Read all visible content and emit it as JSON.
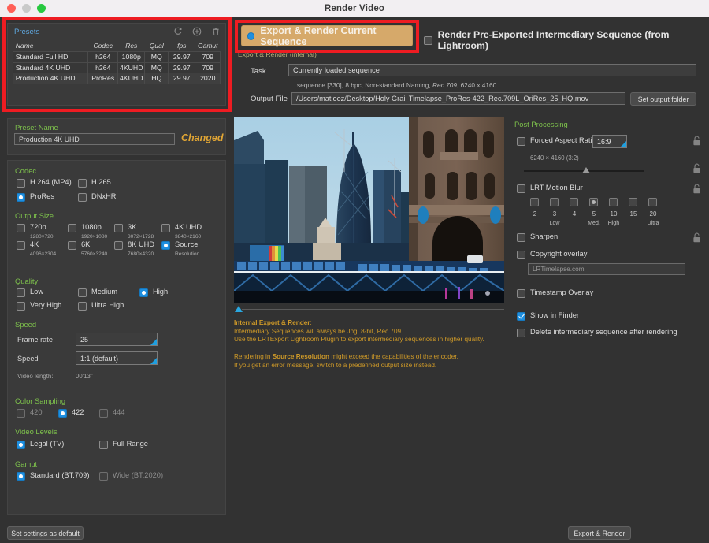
{
  "window": {
    "title": "Render Video"
  },
  "presets": {
    "title": "Presets",
    "icons": {
      "refresh": "refresh-icon",
      "add": "add-circle-icon",
      "delete": "trash-icon"
    },
    "columns": [
      "Name",
      "Codec",
      "Res",
      "Qual",
      "fps",
      "Gamut"
    ],
    "rows": [
      {
        "name": "Standard Full HD",
        "codec": "h264",
        "res": "1080p",
        "qual": "MQ",
        "fps": "29.97",
        "gamut": "709"
      },
      {
        "name": "Standard 4K UHD",
        "codec": "h264",
        "res": "4KUHD",
        "qual": "MQ",
        "fps": "29.97",
        "gamut": "709"
      },
      {
        "name": "Production 4K UHD",
        "codec": "ProRes",
        "res": "4KUHD",
        "qual": "HQ",
        "fps": "29.97",
        "gamut": "2020"
      }
    ]
  },
  "top": {
    "export_render_current": "Export & Render Current Sequence",
    "render_preexported": "Render Pre-Exported Intermediary Sequence (from Lightroom)",
    "section_label": "Export & Render (internal)",
    "task_label": "Task",
    "task_value": "Currently loaded sequence",
    "task_info_pre": "sequence [330], 8 bpc, Non-standard Naming, ",
    "task_info_italic": "Rec.709",
    "task_info_post": ", 6240 x 4160",
    "output_label": "Output File",
    "output_value": "/Users/matjoez/Desktop/Holy Grail Timelapse_ProRes-422_Rec.709L_OriRes_25_HQ.mov",
    "set_output_folder": "Set output folder"
  },
  "preset_name": {
    "title": "Preset Name",
    "value": "Production 4K UHD",
    "status": "Changed"
  },
  "codec": {
    "title": "Codec",
    "options": [
      {
        "label": "H.264 (MP4)",
        "checked": false
      },
      {
        "label": "H.265",
        "checked": false
      },
      {
        "label": "ProRes",
        "checked": true
      },
      {
        "label": "DNxHR",
        "checked": false
      }
    ]
  },
  "output_size": {
    "title": "Output Size",
    "options": [
      {
        "label": "720p",
        "sub": "1280×720",
        "checked": false
      },
      {
        "label": "1080p",
        "sub": "1920×1080",
        "checked": false
      },
      {
        "label": "3K",
        "sub": "3072×1728",
        "checked": false
      },
      {
        "label": "4K UHD",
        "sub": "3840×2160",
        "checked": false
      },
      {
        "label": "4K",
        "sub": "4096×2304",
        "checked": false
      },
      {
        "label": "6K",
        "sub": "5760×3240",
        "checked": false
      },
      {
        "label": "8K UHD",
        "sub": "7680×4320",
        "checked": false
      },
      {
        "label": "Source",
        "sub": "Resolution",
        "checked": true
      }
    ]
  },
  "quality": {
    "title": "Quality",
    "options": [
      {
        "label": "Low",
        "checked": false
      },
      {
        "label": "Medium",
        "checked": false
      },
      {
        "label": "High",
        "checked": true
      },
      {
        "label": "Very High",
        "checked": false
      },
      {
        "label": "Ultra High",
        "checked": false
      }
    ]
  },
  "speed": {
    "title": "Speed",
    "frame_rate_label": "Frame rate",
    "frame_rate_value": "25",
    "speed_label": "Speed",
    "speed_value": "1:1 (default)",
    "video_length_label": "Video length:",
    "video_length_value": "00'13\""
  },
  "color_sampling": {
    "title": "Color Sampling",
    "options": [
      {
        "label": "420",
        "checked": false,
        "dim": true
      },
      {
        "label": "422",
        "checked": true,
        "dim": false
      },
      {
        "label": "444",
        "checked": false,
        "dim": true
      }
    ]
  },
  "video_levels": {
    "title": "Video Levels",
    "options": [
      {
        "label": "Legal (TV)",
        "checked": true,
        "dim": false
      },
      {
        "label": "Full Range",
        "checked": false,
        "dim": false
      }
    ]
  },
  "gamut": {
    "title": "Gamut",
    "options": [
      {
        "label": "Standard (BT.709)",
        "checked": true,
        "dim": false
      },
      {
        "label": "Wide (BT.2020)",
        "checked": false,
        "dim": true
      }
    ]
  },
  "post": {
    "title": "Post Processing",
    "forced_aspect_ratio": {
      "label": "Forced Aspect Ratio",
      "value": "16:9",
      "checked": false
    },
    "dimensions_text": "6240 × 4160 (3:2)",
    "motion_blur": {
      "label": "LRT Motion Blur",
      "checked": false
    },
    "motion_blur_values": [
      "2",
      "3",
      "4",
      "5",
      "10",
      "15",
      "20"
    ],
    "motion_blur_selected": "5",
    "motion_blur_marks": [
      {
        "value": "3",
        "text": "Low"
      },
      {
        "value": "5",
        "text": "Med."
      },
      {
        "value": "10",
        "text": "High"
      },
      {
        "value": "20",
        "text": "Ultra"
      }
    ],
    "sharpen": {
      "label": "Sharpen",
      "checked": false
    },
    "copyright": {
      "label": "Copyright overlay",
      "checked": false,
      "placeholder": "LRTimelapse.com"
    },
    "timestamp": {
      "label": "Timestamp Overlay",
      "checked": false
    },
    "show_in_finder": {
      "label": "Show in Finder",
      "checked": true
    },
    "delete_intermediary": {
      "label": "Delete intermediary sequence after rendering",
      "checked": false
    },
    "lock_icon": "unlocked-padlock-icon"
  },
  "notes": {
    "heading": "Internal Export & Render",
    "line1": "Intermediary Sequences will always be Jpg, 8-bit, Rec.709.",
    "line2": "Use the LRTExport Lightroom Plugin to export intermediary sequences in higher quality.",
    "line3_pre": "Rendering in ",
    "line3_bold": "Source Resolution",
    "line3_post": " might exceed the capabilities of the encoder.",
    "line4": "If you get an error message, switch to a predefined output size instead."
  },
  "footer": {
    "set_default": "Set settings as default",
    "export_render": "Export & Render"
  },
  "colors": {
    "accent_blue": "#1e8fe0",
    "green_heading": "#7ec24c",
    "orange_warning": "#cf9a28",
    "annotation_red": "#ee1c22",
    "highlight_tan": "#d6a96a"
  }
}
